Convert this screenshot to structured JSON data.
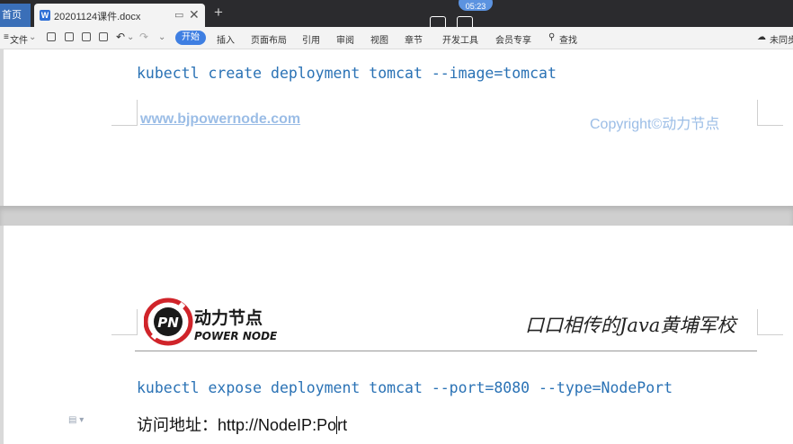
{
  "tabs": {
    "home_label": "首页",
    "doc_label": "20201124课件.docx",
    "doc_badge": "W",
    "new_tab_label": "+"
  },
  "overlay": {
    "time": "05:23"
  },
  "toolbar": {
    "file_label": "文件",
    "start_label": "开始",
    "insert_label": "插入",
    "layout_label": "页面布局",
    "reference_label": "引用",
    "review_label": "审阅",
    "view_label": "视图",
    "chapter_label": "章节",
    "dev_label": "开发工具",
    "vip_label": "会员专享",
    "search_label": "查找",
    "sync_label": "未同步"
  },
  "page1": {
    "command": "kubectl create deployment tomcat --image=tomcat",
    "footer_link": "www.bjpowernode.com",
    "footer_copyright": "Copyright©动力节点"
  },
  "page2": {
    "logo_cn": "动力节点",
    "logo_en": "POWER NODE",
    "logo_mark": "PN",
    "slogan": "口口相传的Java黄埔军校",
    "command": "kubectl expose deployment tomcat --port=8080 --type=NodePort",
    "visit_before_cursor": "访问地址：http://NodeIP:Po",
    "visit_after_cursor": "rt"
  },
  "colors": {
    "code": "#2a72b5",
    "footer": "#9bbde6",
    "accent": "#3f7fe2",
    "logo_red": "#d0242a"
  }
}
